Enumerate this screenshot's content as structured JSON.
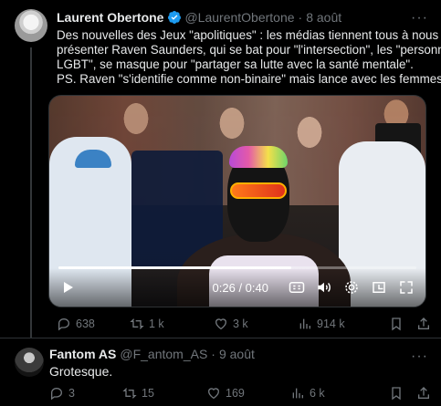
{
  "tweet": {
    "author_name": "Laurent Obertone",
    "handle": "@LaurentObertone",
    "separator": "·",
    "date": "8 août",
    "more": "···",
    "text_lines": [
      "Des nouvelles des Jeux \"apolitiques\" : les médias tiennent tous à nous",
      "présenter Raven Saunders, qui se bat pour \"l'intersection\", les \"personnes",
      "LGBT\", se masque pour \"partager sa lutte avec la santé mentale\".",
      "PS. Raven \"s'identifie comme non-binaire\" mais lance avec les femmes."
    ],
    "video": {
      "time": "0:26 / 0:40",
      "progress_fraction": 0.65
    },
    "actions": {
      "replies": "638",
      "retweets": "1 k",
      "likes": "3 k",
      "views": "914 k"
    }
  },
  "reply": {
    "author_name": "Fantom AS",
    "handle": "@F_antom_AS",
    "separator": "·",
    "date": "9 août",
    "text": "Grotesque.",
    "actions": {
      "replies": "3",
      "retweets": "15",
      "likes": "169",
      "views": "6 k"
    }
  },
  "colors": {
    "background": "#000000",
    "text": "#e7e9ea",
    "muted": "#71767b",
    "verified": "#1d9bf0"
  }
}
